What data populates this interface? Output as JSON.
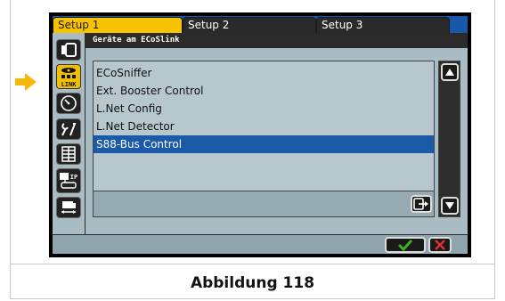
{
  "tabs": [
    {
      "label": "Setup 1",
      "active": true
    },
    {
      "label": "Setup 2",
      "active": false
    },
    {
      "label": "Setup 3",
      "active": false
    }
  ],
  "header": {
    "title": "Geräte am ECoSlink"
  },
  "device_list": {
    "items": [
      {
        "label": "ECoSniffer",
        "selected": false
      },
      {
        "label": "Ext. Booster Control",
        "selected": false
      },
      {
        "label": "L.Net Config",
        "selected": false
      },
      {
        "label": "L.Net Detector",
        "selected": false
      },
      {
        "label": "S88-Bus Control",
        "selected": true
      }
    ]
  },
  "sidebar": {
    "icons": [
      {
        "name": "device-icon",
        "active": false
      },
      {
        "name": "link-icon",
        "active": true,
        "label": "LINK"
      },
      {
        "name": "gauge-icon",
        "active": false
      },
      {
        "name": "tools-icon",
        "active": false
      },
      {
        "name": "list-icon",
        "active": false
      },
      {
        "name": "ip-network-icon",
        "active": false,
        "label": "IP"
      },
      {
        "name": "track-icon",
        "active": false
      }
    ]
  },
  "caption": "Abbildung 118",
  "colors": {
    "active_tab": "#f7c200",
    "selection": "#1a5aa8",
    "ok_check": "#3cb21e",
    "cancel_x": "#e03030",
    "pointer_arrow": "#f5b80a"
  }
}
